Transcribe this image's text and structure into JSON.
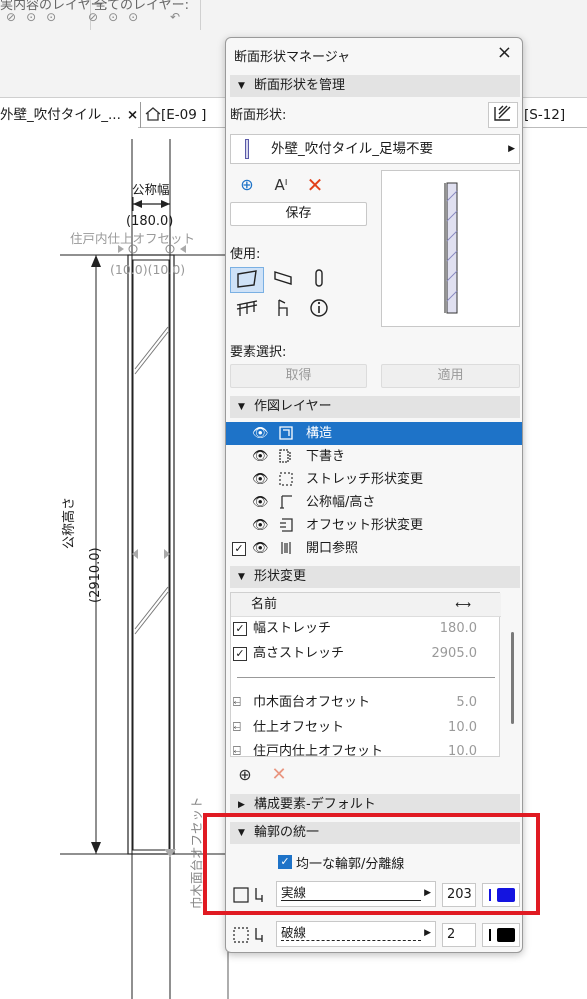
{
  "toolbar": {
    "fragment_left": "実内容のレイヤー:",
    "fragment_right": "全てのレイヤー:"
  },
  "tabs": [
    {
      "label": "外壁_吹付タイル_...",
      "close": "×"
    },
    {
      "label": "[E-09 ]"
    },
    {
      "label": "[S-12]"
    }
  ],
  "drawing": {
    "nominal_width_label": "公称幅",
    "nominal_width_value": "(180.0)",
    "finish_offset_label": "住戸内仕上オフセット",
    "offsets": "(10.0)(10.0)",
    "nominal_height_label": "公称高さ",
    "nominal_height_value": "(2910.0)",
    "baseboard_label": "巾木面台オフセット"
  },
  "panel": {
    "title": "断面形状マネージャ",
    "close": "×",
    "manage_section": "断面形状を管理",
    "profile_label": "断面形状:",
    "profile_name": "外壁_吹付タイル_足場不要",
    "save": "保存",
    "usage_label": "使用:",
    "element_select_label": "要素選択:",
    "get": "取得",
    "apply": "適用",
    "layers_section": "作図レイヤー",
    "layers": [
      "構造",
      "下書き",
      "ストレッチ形状変更",
      "公称幅/高さ",
      "オフセット形状変更",
      "開口参照"
    ],
    "shape_section": "形状変更",
    "table": {
      "col_name": "名前",
      "rows": [
        {
          "name": "幅ストレッチ",
          "value": "180.0"
        },
        {
          "name": "高さストレッチ",
          "value": "2905.0"
        },
        {
          "name": "巾木面台オフセット",
          "value": "5.0"
        },
        {
          "name": "仕上オフセット",
          "value": "10.0"
        },
        {
          "name": "住戸内仕上オフセット",
          "value": "10.0"
        }
      ]
    },
    "components_section": "構成要素-デフォルト",
    "contour_section": "輪郭の統一",
    "uniform_contour": "均一な輪郭/分離線",
    "contour_line": {
      "type": "実線",
      "pen": "203",
      "pen_color": "#1414e0"
    },
    "separator_line": {
      "type": "破線",
      "pen": "2",
      "pen_color": "#000000"
    }
  },
  "colors": {
    "accent": "#1e73c8",
    "highlight_box": "#e01a22"
  }
}
